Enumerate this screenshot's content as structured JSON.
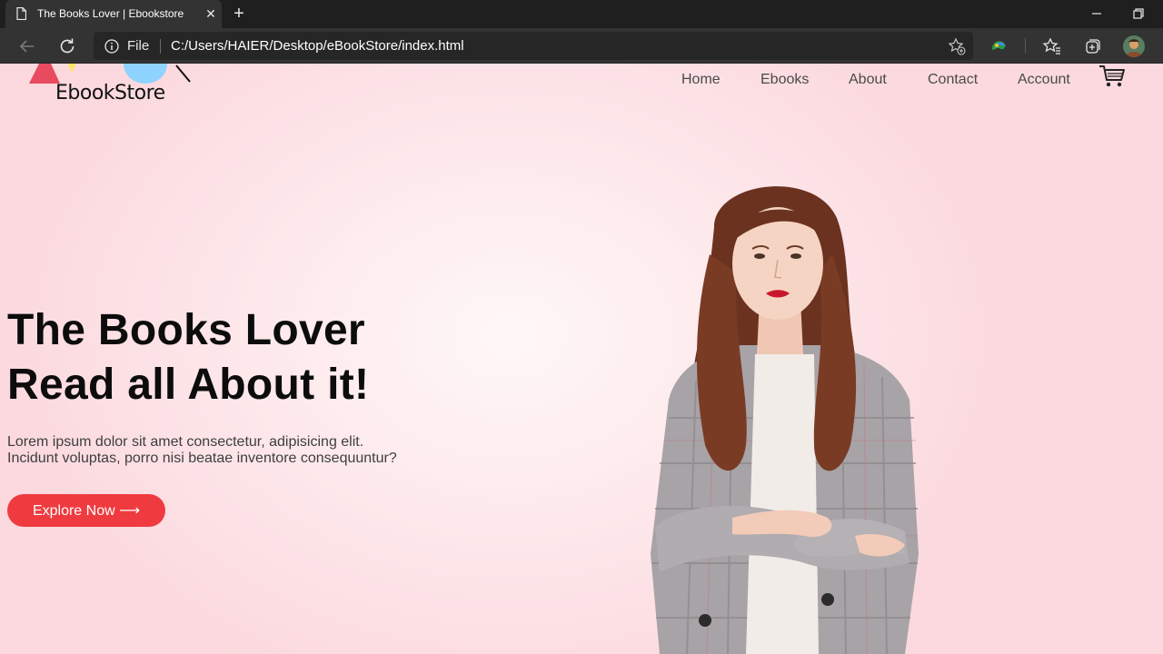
{
  "browser": {
    "tab_title": "The Books Lover | Ebookstore",
    "close_tab_glyph": "✕",
    "new_tab_glyph": "+",
    "address": {
      "scheme_label": "File",
      "url": "C:/Users/HAIER/Desktop/eBookStore/index.html"
    },
    "icons": [
      "document-icon",
      "close-icon",
      "plus-icon",
      "minimize-icon",
      "restore-icon",
      "back-icon",
      "refresh-icon",
      "info-icon",
      "add-favorite-icon",
      "extension-icon",
      "favorites-icon",
      "collections-icon",
      "profile-avatar"
    ]
  },
  "site": {
    "logo_text": "EbookStore",
    "nav": [
      "Home",
      "Ebooks",
      "About",
      "Contact",
      "Account"
    ],
    "hero": {
      "title_line1": "The Books Lover",
      "title_line2": "Read all About it!",
      "para_line1": "Lorem ipsum dolor sit amet consectetur, adipisicing elit.",
      "para_line2": "Incidunt voluptas, porro nisi beatae inventore consequuntur?",
      "button": "Explore Now ⟶"
    },
    "colors": {
      "accent": "#ef3b3f",
      "background": "#fde7ea",
      "chrome_dark": "#1f1f1f",
      "chrome_tab": "#333333"
    }
  }
}
